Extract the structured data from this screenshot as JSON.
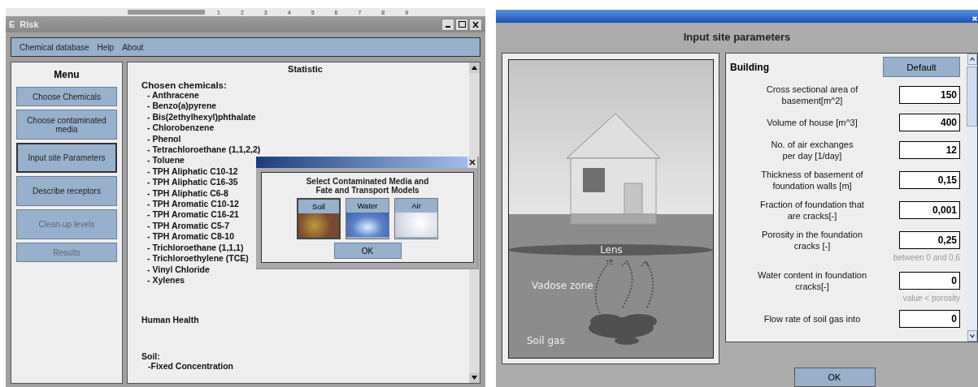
{
  "left_window": {
    "ruler": [
      "1",
      "2",
      "3",
      "4",
      "5",
      "6",
      "7",
      "8",
      "9"
    ],
    "title_icon": "E",
    "title": "Risk",
    "menu_bar": [
      "Chemical database",
      "Help",
      "About"
    ],
    "sidebar": {
      "title": "Menu",
      "items": [
        {
          "label": "Choose Chemicals",
          "selected": false,
          "disabled": false
        },
        {
          "label": "Choose contaminated media",
          "selected": false,
          "disabled": false
        },
        {
          "label": "Input site Parameters",
          "selected": true,
          "disabled": false
        },
        {
          "label": "Describe receptors",
          "selected": false,
          "disabled": false
        },
        {
          "label": "Clean-up levels",
          "selected": false,
          "disabled": true
        },
        {
          "label": "Results",
          "selected": false,
          "disabled": true
        }
      ]
    },
    "statistic": {
      "title": "Statistic",
      "chosen_heading": "Chosen chemicals:",
      "chemicals": [
        "- Anthracene",
        "- Benzo(a)pyrene",
        "- Bis(2ethylhexyl)phthalate",
        "- Chlorobenzene",
        "- Phenol",
        "- Tetrachloroethane (1,1,2,2)",
        "- Toluene",
        "- TPH Aliphatic C10-12",
        "- TPH Aliphatic C16-35",
        "- TPH Aliphatic C6-8",
        "- TPH Aromatic C10-12",
        "- TPH Aromatic C16-21",
        "- TPH Aromatic C5-7",
        "- TPH Aromatic C8-10",
        "- Trichloroethane (1,1,1)",
        "- Trichloroethylene (TCE)",
        "- Vinyl Chloride",
        "- Xylenes"
      ],
      "receptor": "Human Health",
      "medium": "Soil:",
      "model": "-Fixed Concentration"
    },
    "dialog": {
      "title": "Select Contaminated Media and Fate and Transport Models",
      "media": [
        {
          "label": "Soil",
          "kind": "soil",
          "selected": true
        },
        {
          "label": "Water",
          "kind": "water",
          "selected": false
        },
        {
          "label": "Air",
          "kind": "air",
          "selected": false
        }
      ],
      "ok": "OK"
    }
  },
  "right_window": {
    "heading": "Input site parameters",
    "diagram": {
      "lens": "Lens",
      "vadose": "Vadose zone",
      "soil_gas": "Soil gas"
    },
    "section": "Building",
    "default_button": "Default",
    "parameters": [
      {
        "label": "Cross sectional area of\nbasement[m^2]",
        "value": "150"
      },
      {
        "label": "Volume of house [m^3]",
        "value": "400"
      },
      {
        "label": "No. of air exchanges\nper day [1/day]",
        "value": "12"
      },
      {
        "label": "Thickness of basement of\nfoundation walls [m]",
        "value": "0,15"
      },
      {
        "label": "Fraction of foundation that\nare cracks[-]",
        "value": "0,001"
      },
      {
        "label": "Porosity in the foundation\ncracks [-]",
        "value": "0,25",
        "hint": "between 0 and 0,6"
      },
      {
        "label": "Water content in foundation\ncracks[-]",
        "value": "0",
        "hint": "value < porosity"
      },
      {
        "label": "Flow rate of soil gas into",
        "value": "0"
      }
    ],
    "ok": "OK"
  }
}
